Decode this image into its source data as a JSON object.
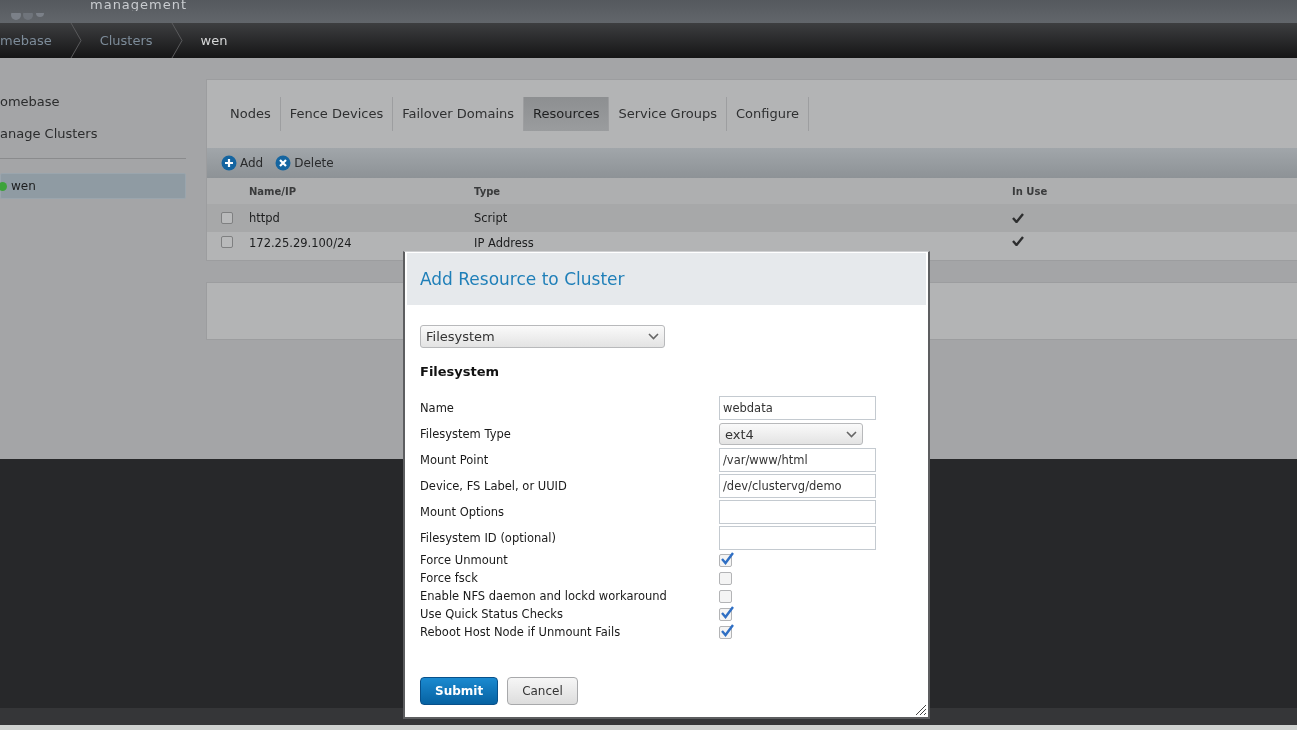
{
  "header": {
    "subtitle": "management"
  },
  "breadcrumb": [
    {
      "label": "mebase",
      "selected": false
    },
    {
      "label": "Clusters",
      "selected": false
    },
    {
      "label": "wen",
      "selected": true
    }
  ],
  "sidebar": {
    "items": [
      "omebase",
      "anage Clusters"
    ],
    "clusters": [
      {
        "name": "wen",
        "selected": true
      }
    ]
  },
  "tabs": [
    {
      "label": "Nodes",
      "selected": false
    },
    {
      "label": "Fence Devices",
      "selected": false
    },
    {
      "label": "Failover Domains",
      "selected": false
    },
    {
      "label": "Resources",
      "selected": true
    },
    {
      "label": "Service Groups",
      "selected": false
    },
    {
      "label": "Configure",
      "selected": false
    }
  ],
  "toolbar": [
    {
      "kind": "add",
      "label": "Add"
    },
    {
      "kind": "delete",
      "label": "Delete"
    }
  ],
  "table": {
    "columns": [
      "Name/IP",
      "Type",
      "In Use"
    ],
    "rows": [
      {
        "checked": false,
        "name": "httpd",
        "type": "Script",
        "in_use": true
      },
      {
        "checked": false,
        "name": "172.25.29.100/24",
        "type": "IP Address",
        "in_use": true
      }
    ]
  },
  "modal": {
    "title": "Add Resource to Cluster",
    "resource_type": "Filesystem",
    "section": "Filesystem",
    "fields": [
      {
        "kind": "text",
        "label": "Name",
        "value": "webdata"
      },
      {
        "kind": "select",
        "label": "Filesystem Type",
        "value": "ext4"
      },
      {
        "kind": "text",
        "label": "Mount Point",
        "value": "/var/www/html"
      },
      {
        "kind": "text",
        "label": "Device, FS Label, or UUID",
        "value": "/dev/clustervg/demo"
      },
      {
        "kind": "text",
        "label": "Mount Options"
      },
      {
        "kind": "text",
        "label": "Filesystem ID (optional)"
      }
    ],
    "options": [
      {
        "label": "Force Unmount",
        "checked": true
      },
      {
        "label": "Force fsck",
        "checked": false
      },
      {
        "label": "Enable NFS daemon and lockd workaround",
        "checked": false
      },
      {
        "label": "Use Quick Status Checks",
        "checked": true
      },
      {
        "label": "Reboot Host Node if Unmount Fails",
        "checked": true
      }
    ],
    "buttons": [
      {
        "kind": "primary",
        "label": "Submit"
      },
      {
        "kind": "secondary",
        "label": "Cancel"
      }
    ]
  }
}
